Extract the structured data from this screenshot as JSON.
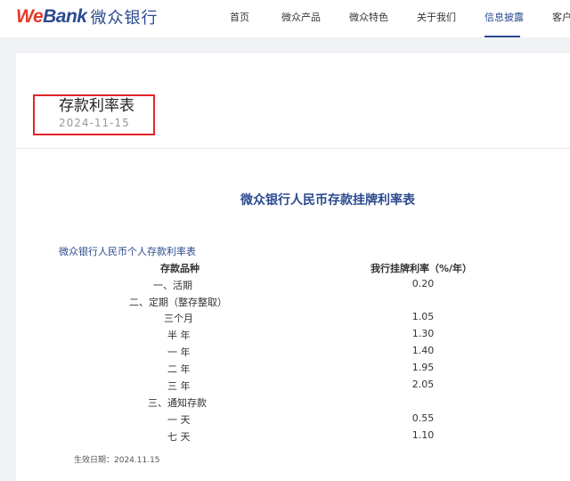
{
  "header": {
    "logo_we": "We",
    "logo_bank": "Bank",
    "logo_cn": "微众银行",
    "nav": [
      {
        "label": "首页"
      },
      {
        "label": "微众产品"
      },
      {
        "label": "微众特色"
      },
      {
        "label": "关于我们"
      },
      {
        "label": "信息披露"
      },
      {
        "label": "客户"
      }
    ],
    "active_index": 4,
    "accent_color": "#2b4a8f",
    "logo_red": "#e23b2a"
  },
  "page": {
    "title": "存款利率表",
    "date": "2024-11-15",
    "highlight_color": "#e0252a"
  },
  "document": {
    "heading": "微众银行人民币存款挂牌利率表",
    "table_caption": "微众银行人民币个人存款利率表",
    "columns": [
      "存款品种",
      "我行挂牌利率（%/年）"
    ],
    "rows": [
      {
        "label": "一、活期",
        "value": "0.20"
      },
      {
        "label": "二、定期（整存整取）",
        "value": ""
      },
      {
        "label": "三个月",
        "value": "1.05"
      },
      {
        "label": "半 年",
        "value": "1.30"
      },
      {
        "label": "一 年",
        "value": "1.40"
      },
      {
        "label": "二 年",
        "value": "1.95"
      },
      {
        "label": "三 年",
        "value": "2.05"
      },
      {
        "label": "三、通知存款",
        "value": ""
      },
      {
        "label": "一 天",
        "value": "0.55"
      },
      {
        "label": "七 天",
        "value": "1.10"
      }
    ],
    "effective_date": "生效日期：2024.11.15"
  }
}
